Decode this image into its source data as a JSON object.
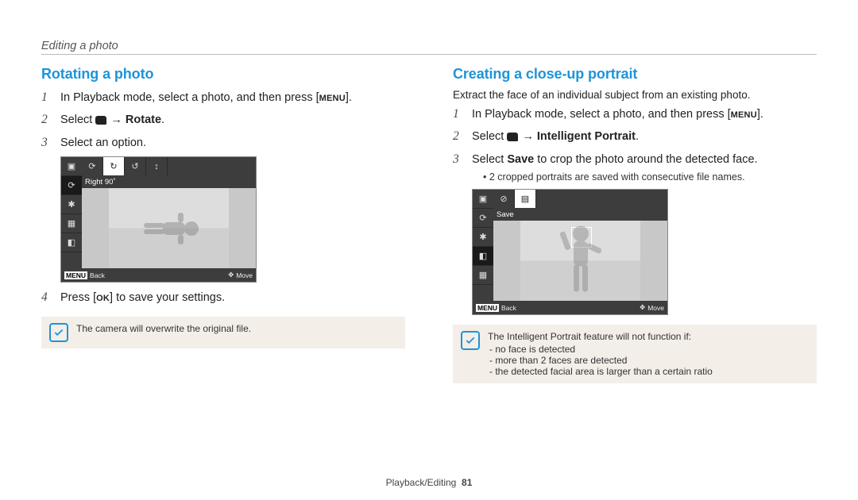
{
  "header": "Editing a photo",
  "footer": {
    "section": "Playback/Editing",
    "page": "81"
  },
  "left": {
    "heading": "Rotating a photo",
    "step1_pre": "In Playback mode, select a photo, and then press [",
    "step1_btn": "MENU",
    "step1_post": "].",
    "step2_pre": "Select ",
    "step2_arrow": " → ",
    "step2_bold": "Rotate",
    "step3": "Select an option.",
    "step4_pre": "Press [",
    "step4_btn": "OK",
    "step4_post": "] to save your settings.",
    "note": "The camera will overwrite the original file.",
    "shot": {
      "label": "Right 90˚",
      "back": "Back",
      "move": "Move",
      "menu": "MENU"
    }
  },
  "right": {
    "heading": "Creating a close-up portrait",
    "intro": "Extract the face of an individual subject from an existing photo.",
    "step1_pre": "In Playback mode, select a photo, and then press [",
    "step1_btn": "MENU",
    "step1_post": "].",
    "step2_pre": "Select ",
    "step2_arrow": " → ",
    "step2_bold": "Intelligent Portrait",
    "step3_pre": "Select ",
    "step3_bold": "Save",
    "step3_post": " to crop the photo around the detected face.",
    "step3_sub": "2 cropped portraits are saved with consecutive file names.",
    "note_head": "The Intelligent Portrait feature will not function if:",
    "note_items": [
      "no face is detected",
      "more than 2 faces are detected",
      "the detected facial area is larger than a certain ratio"
    ],
    "shot": {
      "label": "Save",
      "back": "Back",
      "move": "Move",
      "menu": "MENU"
    }
  }
}
